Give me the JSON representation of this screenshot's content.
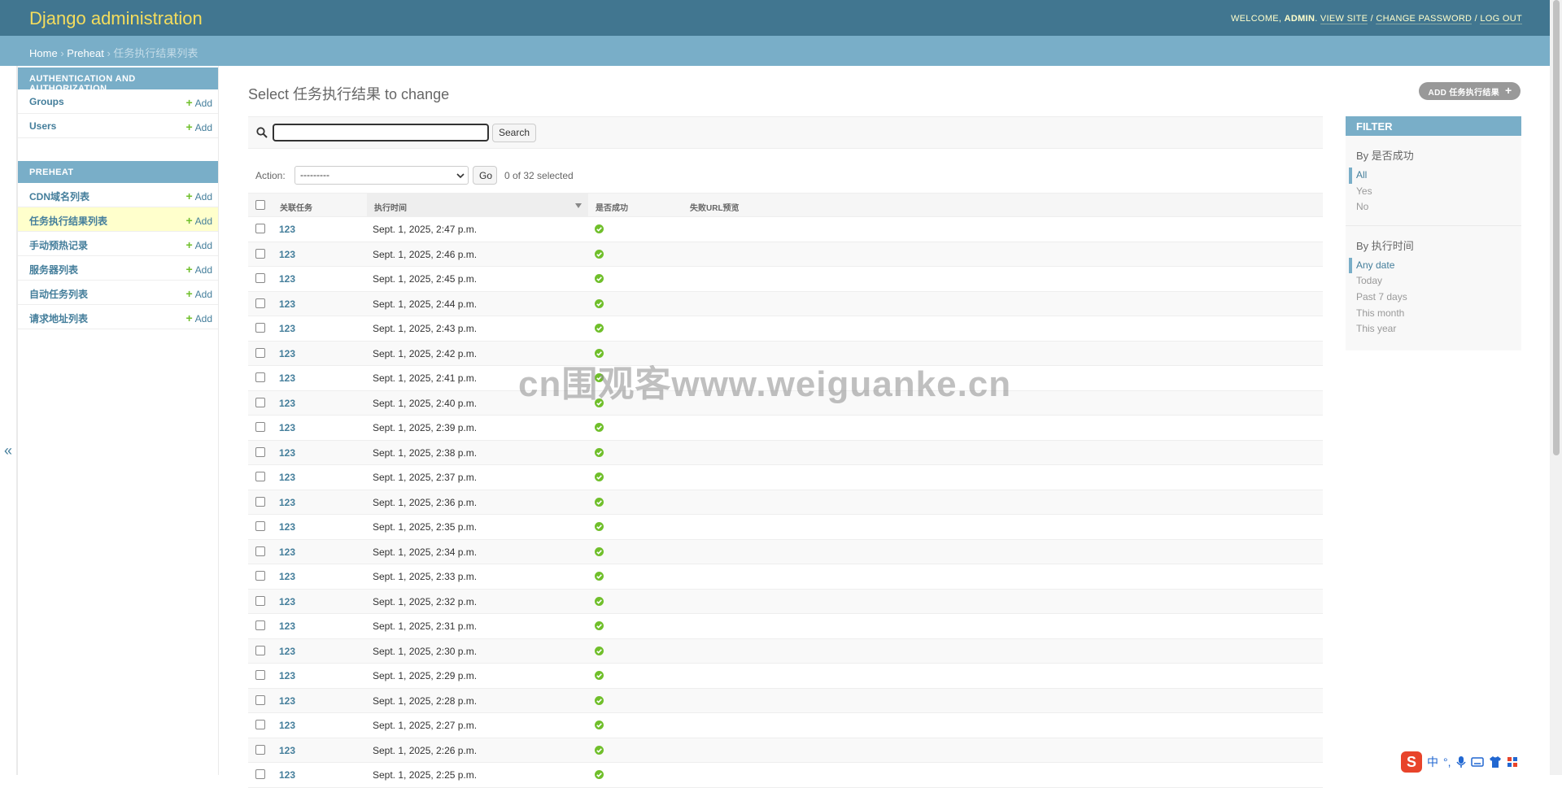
{
  "header": {
    "site_name": "Django administration",
    "welcome": "WELCOME,",
    "user": "ADMIN",
    "links": [
      "VIEW SITE",
      "CHANGE PASSWORD",
      "LOG OUT"
    ]
  },
  "breadcrumbs": {
    "home": "Home",
    "app": "Preheat",
    "current": "任务执行结果列表",
    "sep": "›"
  },
  "sidebar": {
    "modules": [
      {
        "caption": "Authentication and Authorization",
        "items": [
          {
            "label": "Groups",
            "add": "Add"
          },
          {
            "label": "Users",
            "add": "Add"
          }
        ]
      },
      {
        "caption": "Preheat",
        "items": [
          {
            "label": "CDN域名列表",
            "add": "Add"
          },
          {
            "label": "任务执行结果列表",
            "add": "Add",
            "current": true
          },
          {
            "label": "手动预热记录",
            "add": "Add"
          },
          {
            "label": "服务器列表",
            "add": "Add"
          },
          {
            "label": "自动任务列表",
            "add": "Add"
          },
          {
            "label": "请求地址列表",
            "add": "Add"
          }
        ]
      }
    ],
    "toggle_glyph": "«"
  },
  "content": {
    "title": "Select 任务执行结果 to change",
    "add_button": "ADD 任务执行结果",
    "search_button": "Search",
    "search_value": "",
    "action_label": "Action:",
    "action_selected": "---------",
    "go_button": "Go",
    "counter": "0 of 32 selected"
  },
  "table": {
    "columns": [
      "关联任务",
      "执行时间",
      "是否成功",
      "失败URL预览"
    ],
    "rows": [
      {
        "task": "123",
        "time": "Sept. 1, 2025, 2:47 p.m."
      },
      {
        "task": "123",
        "time": "Sept. 1, 2025, 2:46 p.m."
      },
      {
        "task": "123",
        "time": "Sept. 1, 2025, 2:45 p.m."
      },
      {
        "task": "123",
        "time": "Sept. 1, 2025, 2:44 p.m."
      },
      {
        "task": "123",
        "time": "Sept. 1, 2025, 2:43 p.m."
      },
      {
        "task": "123",
        "time": "Sept. 1, 2025, 2:42 p.m."
      },
      {
        "task": "123",
        "time": "Sept. 1, 2025, 2:41 p.m."
      },
      {
        "task": "123",
        "time": "Sept. 1, 2025, 2:40 p.m."
      },
      {
        "task": "123",
        "time": "Sept. 1, 2025, 2:39 p.m."
      },
      {
        "task": "123",
        "time": "Sept. 1, 2025, 2:38 p.m."
      },
      {
        "task": "123",
        "time": "Sept. 1, 2025, 2:37 p.m."
      },
      {
        "task": "123",
        "time": "Sept. 1, 2025, 2:36 p.m."
      },
      {
        "task": "123",
        "time": "Sept. 1, 2025, 2:35 p.m."
      },
      {
        "task": "123",
        "time": "Sept. 1, 2025, 2:34 p.m."
      },
      {
        "task": "123",
        "time": "Sept. 1, 2025, 2:33 p.m."
      },
      {
        "task": "123",
        "time": "Sept. 1, 2025, 2:32 p.m."
      },
      {
        "task": "123",
        "time": "Sept. 1, 2025, 2:31 p.m."
      },
      {
        "task": "123",
        "time": "Sept. 1, 2025, 2:30 p.m."
      },
      {
        "task": "123",
        "time": "Sept. 1, 2025, 2:29 p.m."
      },
      {
        "task": "123",
        "time": "Sept. 1, 2025, 2:28 p.m."
      },
      {
        "task": "123",
        "time": "Sept. 1, 2025, 2:27 p.m."
      },
      {
        "task": "123",
        "time": "Sept. 1, 2025, 2:26 p.m."
      },
      {
        "task": "123",
        "time": "Sept. 1, 2025, 2:25 p.m."
      }
    ]
  },
  "filter": {
    "title": "FILTER",
    "groups": [
      {
        "heading": "By 是否成功",
        "options": [
          "All",
          "Yes",
          "No"
        ],
        "selected": 0
      },
      {
        "heading": "By 执行时间",
        "options": [
          "Any date",
          "Today",
          "Past 7 days",
          "This month",
          "This year"
        ],
        "selected": 0
      }
    ]
  },
  "watermark": "cn围观客www.weiguanke.cn",
  "tray": {
    "ime": "S",
    "lang": "中",
    "punct": "°,"
  },
  "colors": {
    "header_bg": "#417690",
    "branding": "#f5dd5d",
    "accent": "#79aec8",
    "link": "#447e9b",
    "current_row": "#ffffcc",
    "success_icon": "#70bf2b"
  }
}
